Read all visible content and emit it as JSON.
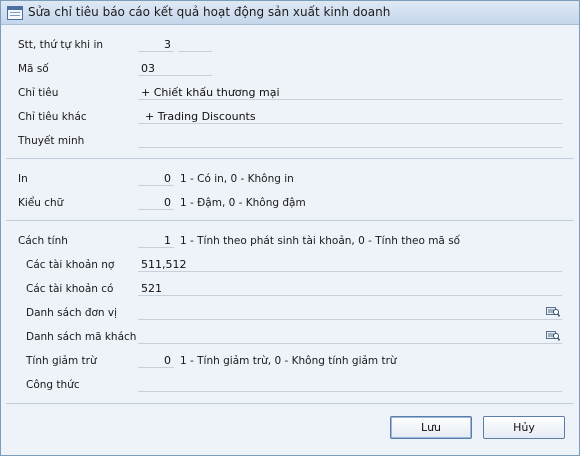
{
  "window": {
    "title": "Sửa chỉ tiêu báo cáo kết quả hoạt động sản xuất kinh doanh"
  },
  "fields": {
    "stt": {
      "label": "Stt, thứ tự khi in",
      "value": "3"
    },
    "ma_so": {
      "label": "Mã số",
      "value": "03"
    },
    "chi_tieu": {
      "label": "Chỉ tiêu",
      "value": "+ Chiết khấu thương mại"
    },
    "chi_tieu_khac": {
      "label": "Chỉ tiêu khác",
      "value": "+ Trading Discounts"
    },
    "thuyet_minh": {
      "label": "Thuyết minh",
      "value": ""
    },
    "in": {
      "label": "In",
      "value": "0",
      "hint": "1 - Có in, 0 - Không in"
    },
    "kieu_chu": {
      "label": "Kiểu chữ",
      "value": "0",
      "hint": "1 - Đậm, 0 - Không đậm"
    },
    "cach_tinh": {
      "label": "Cách tính",
      "value": "1",
      "hint": "1 - Tính theo phát sinh tài khoản, 0 - Tính theo mã số"
    },
    "tk_no": {
      "label": "Các tài khoản nợ",
      "value": "511,512"
    },
    "tk_co": {
      "label": "Các tài khoản có",
      "value": "521"
    },
    "ds_don_vi": {
      "label": "Danh sách đơn vị",
      "value": "",
      "icon": "lookup-icon"
    },
    "ds_ma_khach": {
      "label": "Danh sách mã khách",
      "value": "",
      "icon": "lookup-icon"
    },
    "tinh_giam_tru": {
      "label": "Tính giảm trừ",
      "value": "0",
      "hint": "1 - Tính giảm trừ, 0 - Không tính giảm trừ"
    },
    "cong_thuc": {
      "label": "Công thức",
      "value": ""
    }
  },
  "buttons": {
    "save": "Lưu",
    "cancel": "Hủy"
  }
}
